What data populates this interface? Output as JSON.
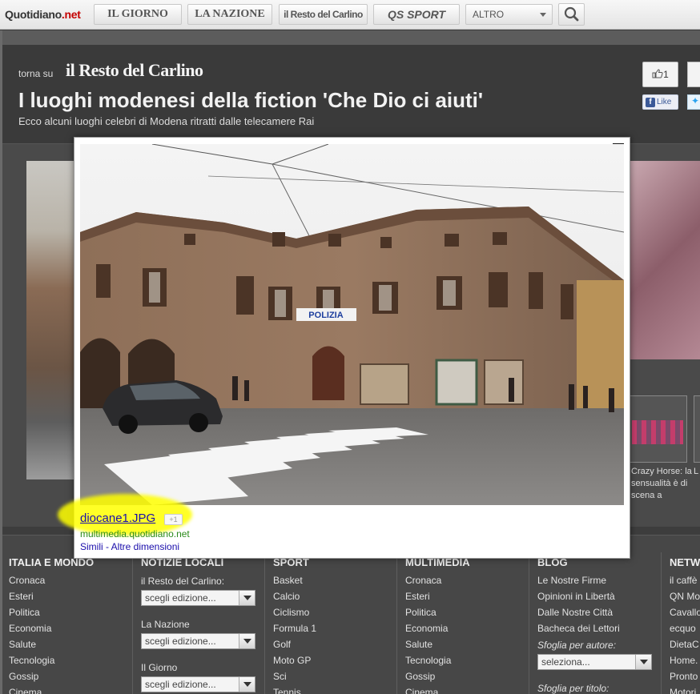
{
  "topbar": {
    "brand": "Quotidiano",
    "brand_suffix": ".net",
    "nav": [
      {
        "label": "IL GIORNO"
      },
      {
        "label": "LA NAZIONE"
      },
      {
        "label": "il Resto del Carlino"
      },
      {
        "label": "QS SPORT"
      }
    ],
    "altro": "ALTRO"
  },
  "header": {
    "torna_label": "torna su",
    "carlino_logo": "il Resto del Carlino",
    "title": "I luoghi modenesi della fiction 'Che Dio ci aiuti'",
    "subtitle": "Ecco alcuni luoghi celebri di Modena ritratti dalle telecamere Rai",
    "like_count": "1",
    "fb_like": "Like"
  },
  "gallery": {
    "thumb_caption": "Crazy Horse: la sensualità è di scena a",
    "thumb_caption2": "L"
  },
  "modal": {
    "filename": "diocane1.JPG",
    "plus_one": "+1",
    "source": "multimedia.quotidiano.net",
    "simili": "Simili - Altre dimensioni",
    "photo_sign": "POLIZIA"
  },
  "footer": {
    "col1": {
      "title": "ITALIA E MONDO",
      "items": [
        "Cronaca",
        "Esteri",
        "Politica",
        "Economia",
        "Salute",
        "Tecnologia",
        "Gossip",
        "Cinema"
      ]
    },
    "col2": {
      "title": "NOTIZIE LOCALI",
      "labels": [
        "il Resto del Carlino:",
        "La Nazione",
        "Il Giorno"
      ],
      "select": "scegli edizione..."
    },
    "col3": {
      "title": "SPORT",
      "items": [
        "Basket",
        "Calcio",
        "Ciclismo",
        "Formula 1",
        "Golf",
        "Moto GP",
        "Sci",
        "Tennis"
      ]
    },
    "col4": {
      "title": "MULTIMEDIA",
      "items": [
        "Cronaca",
        "Esteri",
        "Politica",
        "Economia",
        "Salute",
        "Tecnologia",
        "Gossip",
        "Cinema"
      ]
    },
    "col5": {
      "title": "BLOG",
      "items": [
        "Le Nostre Firme",
        "Opinioni in Libertà",
        "Dalle Nostre Città",
        "Bacheca dei Lettori"
      ],
      "autore_label": "Sfoglia per autore:",
      "autore_select": "seleziona...",
      "titolo_label": "Sfoglia per titolo:"
    },
    "col6": {
      "title": "NETW",
      "items": [
        "il caffè",
        "QN Mo",
        "Cavallo",
        "ecquo",
        "DietaC",
        "Home.",
        "Pronto",
        "Motori"
      ]
    }
  }
}
